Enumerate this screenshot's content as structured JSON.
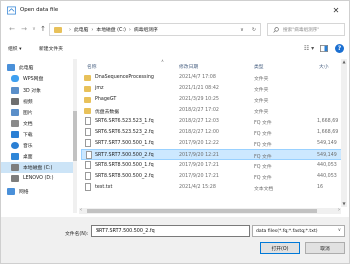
{
  "window": {
    "title": "Open data file"
  },
  "nav": {
    "crumbs": [
      "此电脑",
      "本地磁盘 (C:)",
      "病毒组测序"
    ],
    "search_placeholder": "搜索\"病毒组测序\""
  },
  "toolbar": {
    "organize": "组织 ▾",
    "new_folder": "新建文件夹"
  },
  "sidebar": {
    "items": [
      {
        "label": "此电脑",
        "icon": "computer-icon",
        "color": "#4a90d9"
      },
      {
        "label": "WPS网盘",
        "icon": "cloud-icon",
        "color": "#3fa0f0"
      },
      {
        "label": "3D 对象",
        "icon": "cube-icon",
        "color": "#5b8fc9"
      },
      {
        "label": "视频",
        "icon": "video-icon",
        "color": "#6f6f6f"
      },
      {
        "label": "图片",
        "icon": "picture-icon",
        "color": "#5b8fc9"
      },
      {
        "label": "文档",
        "icon": "document-icon",
        "color": "#8a8a8a"
      },
      {
        "label": "下载",
        "icon": "download-icon",
        "color": "#2a7fd4"
      },
      {
        "label": "音乐",
        "icon": "music-icon",
        "color": "#2a7fd4"
      },
      {
        "label": "桌面",
        "icon": "desktop-icon",
        "color": "#2f86d8"
      },
      {
        "label": "本地磁盘 (C:)",
        "icon": "drive-icon",
        "color": "#7d7d7d"
      },
      {
        "label": "LENOVO (D:)",
        "icon": "drive-icon",
        "color": "#7d7d7d"
      },
      {
        "label": "网络",
        "icon": "network-icon",
        "color": "#4a90d9"
      }
    ]
  },
  "columns": {
    "name": "名称",
    "date": "修改日期",
    "type": "类型",
    "size": "大小"
  },
  "files": [
    {
      "name": "DnaSequenceProcessing",
      "date": "2021/4/7 17:08",
      "type": "文件夹",
      "size": "",
      "kind": "folder"
    },
    {
      "name": "jmz",
      "date": "2021/1/21 08:42",
      "type": "文件夹",
      "size": "",
      "kind": "folder"
    },
    {
      "name": "PhageGT",
      "date": "2021/3/29 10:25",
      "type": "文件夹",
      "size": "",
      "kind": "folder"
    },
    {
      "name": "优盘去数据",
      "date": "2018/2/27 17:02",
      "type": "文件夹",
      "size": "",
      "kind": "folder"
    },
    {
      "name": "SRT6.SRT6.523.523_1.fq",
      "date": "2018/2/27 12:03",
      "type": "FQ 文件",
      "size": "1,668,69",
      "kind": "file"
    },
    {
      "name": "SRT6.SRT6.523.523_2.fq",
      "date": "2018/2/27 12:00",
      "type": "FQ 文件",
      "size": "1,668,69",
      "kind": "file"
    },
    {
      "name": "SRT7.SRT7.500.500_1.fq",
      "date": "2017/9/20 12:22",
      "type": "FQ 文件",
      "size": "549,149",
      "kind": "file"
    },
    {
      "name": "SRT7.SRT7.500.500_2.fq",
      "date": "2017/9/20 12:21",
      "type": "FQ 文件",
      "size": "549,149",
      "kind": "file",
      "selected": true
    },
    {
      "name": "SRT8.SRT8.500.500_1.fq",
      "date": "2017/9/20 17:21",
      "type": "FQ 文件",
      "size": "440,053",
      "kind": "file"
    },
    {
      "name": "SRT8.SRT8.500.500_2.fq",
      "date": "2017/9/20 17:21",
      "type": "FQ 文件",
      "size": "440,053",
      "kind": "file"
    },
    {
      "name": "test.txt",
      "date": "2021/4/2 15:28",
      "type": "文本文档",
      "size": "16",
      "kind": "file"
    }
  ],
  "footer": {
    "filename_label": "文件名(N):",
    "filename_value": "SRT7.SRT7.500.500_2.fq",
    "filter_value": "data files(*.fq;*.fastq;*.txt)",
    "open_label": "打开(O)",
    "cancel_label": "取消"
  },
  "colors": {
    "selected_row": "#cce8ff",
    "accent": "#0078d7",
    "folder": "#e8c15a"
  }
}
